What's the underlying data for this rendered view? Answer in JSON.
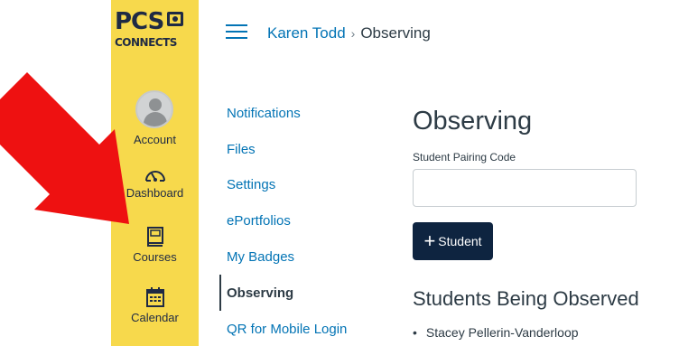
{
  "logo": {
    "line1": "PCS",
    "line2": "CONNECTS"
  },
  "global_nav": {
    "items": [
      {
        "label": "Account",
        "icon": "avatar"
      },
      {
        "label": "Dashboard",
        "icon": "dashboard-gauge-icon"
      },
      {
        "label": "Courses",
        "icon": "book-icon"
      },
      {
        "label": "Calendar",
        "icon": "calendar-icon"
      }
    ]
  },
  "header": {
    "breadcrumb_user": "Karen Todd",
    "breadcrumb_separator": "›",
    "breadcrumb_current": "Observing"
  },
  "secondary_nav": {
    "items": [
      {
        "label": "Notifications"
      },
      {
        "label": "Files"
      },
      {
        "label": "Settings"
      },
      {
        "label": "ePortfolios"
      },
      {
        "label": "My Badges"
      },
      {
        "label": "Observing"
      },
      {
        "label": "QR for Mobile Login"
      }
    ],
    "active": "Observing"
  },
  "main": {
    "title": "Observing",
    "pairing_label": "Student Pairing Code",
    "pairing_value": "",
    "add_button_plus": "+",
    "add_button_label": "Student",
    "section_title": "Students Being Observed",
    "students": [
      "Stacey Pellerin-Vanderloop"
    ]
  },
  "colors": {
    "nav_bg": "#f7d94c",
    "link": "#0374b5",
    "button_bg": "#0e2440",
    "arrow": "#ee1111"
  }
}
